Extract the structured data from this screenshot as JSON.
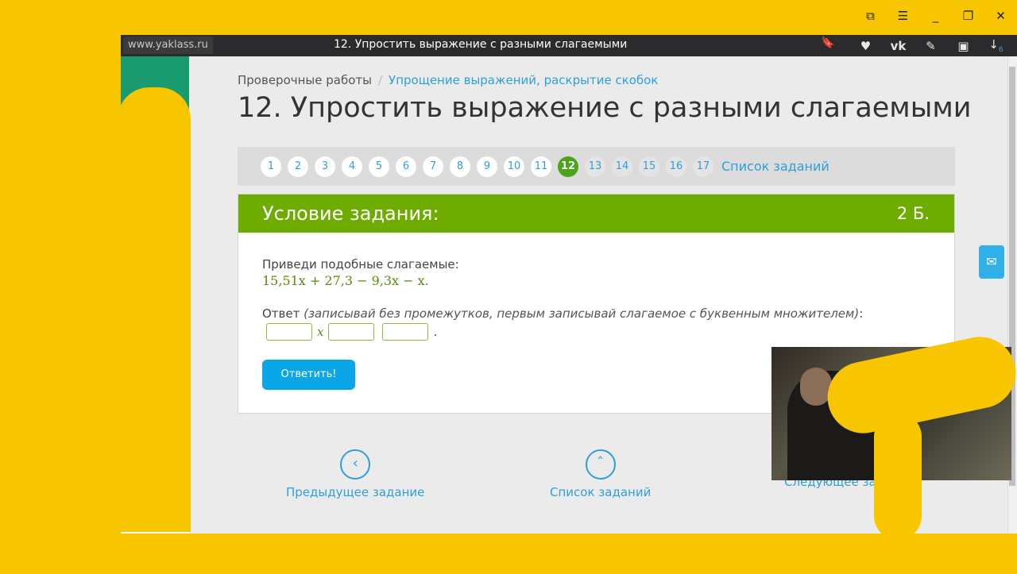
{
  "browser": {
    "url": "www.yaklass.ru",
    "tab_title": "12. Упростить выражение с разными слагаемыми",
    "extensions_badge": "6"
  },
  "breadcrumb": {
    "root": "Проверочные работы",
    "current": "Упрощение выражений, раскрытие скобок"
  },
  "page_title": "12. Упростить выражение с разными слагаемыми",
  "task_nav": {
    "numbers": [
      "1",
      "2",
      "3",
      "4",
      "5",
      "6",
      "7",
      "8",
      "9",
      "10",
      "11",
      "12",
      "13",
      "14",
      "15",
      "16",
      "17"
    ],
    "current": "12",
    "list_label": "Список заданий"
  },
  "task": {
    "header": "Условие задания:",
    "points": "2 Б.",
    "question": "Приведи подобные слагаемые:",
    "expression": "15,51x + 27,3 − 9,3x − x.",
    "answer_label": "Ответ",
    "answer_hint": "(записывай без промежутков, первым записывай слагаемое с буквенным множителем)",
    "answer_colon": ":",
    "var": "x",
    "end_dot": ".",
    "submit": "Ответить!"
  },
  "bottom_nav": {
    "prev": "Предыдущее задание",
    "list": "Список заданий",
    "next": "Следующее зад"
  },
  "colors": {
    "accent_green": "#6fac00",
    "link_blue": "#2f9fd8",
    "button_blue": "#0aa6e8",
    "overlay_yellow": "#f7c600"
  }
}
